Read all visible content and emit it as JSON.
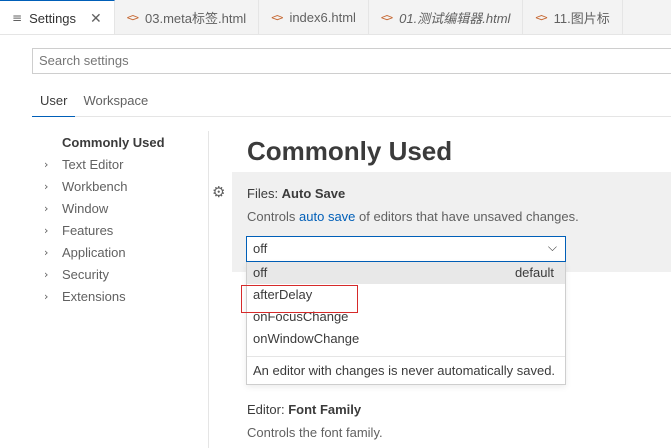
{
  "tabs": [
    {
      "icon": "settings-lines-icon",
      "glyph": "≡",
      "label": "Settings",
      "close": "✕",
      "active": true,
      "italic": false
    },
    {
      "icon": "html-brackets-icon",
      "glyph": "<>",
      "label": "03.meta标签.html",
      "active": false,
      "italic": false
    },
    {
      "icon": "html-brackets-icon",
      "glyph": "<>",
      "label": "index6.html",
      "active": false,
      "italic": false
    },
    {
      "icon": "html-brackets-icon",
      "glyph": "<>",
      "label": "01.测试编辑器.html",
      "active": false,
      "italic": true
    },
    {
      "icon": "html-brackets-icon",
      "glyph": "<>",
      "label": "11.图片标",
      "active": false,
      "italic": false
    }
  ],
  "search": {
    "placeholder": "Search settings"
  },
  "scope": {
    "user": "User",
    "workspace": "Workspace"
  },
  "toc": [
    {
      "label": "Commonly Used",
      "chevron": "",
      "active": true
    },
    {
      "label": "Text Editor",
      "chevron": "›",
      "active": false
    },
    {
      "label": "Workbench",
      "chevron": "›",
      "active": false
    },
    {
      "label": "Window",
      "chevron": "›",
      "active": false
    },
    {
      "label": "Features",
      "chevron": "›",
      "active": false
    },
    {
      "label": "Application",
      "chevron": "›",
      "active": false
    },
    {
      "label": "Security",
      "chevron": "›",
      "active": false
    },
    {
      "label": "Extensions",
      "chevron": "›",
      "active": false
    }
  ],
  "main": {
    "section_title": "Commonly Used",
    "gear_glyph": "⚙",
    "auto_save": {
      "category": "Files: ",
      "name": "Auto Save",
      "desc_before": "Controls ",
      "desc_link": "auto save",
      "desc_after": " of editors that have unsaved changes.",
      "value": "off",
      "arrow": "⌵",
      "options": [
        {
          "label": "off",
          "note": "default",
          "selected": true
        },
        {
          "label": "afterDelay",
          "note": "",
          "selected": false
        },
        {
          "label": "onFocusChange",
          "note": "",
          "selected": false
        },
        {
          "label": "onWindowChange",
          "note": "",
          "selected": false
        }
      ],
      "option_description": "An editor with changes is never automatically saved."
    },
    "font_family": {
      "category": "Editor: ",
      "name": "Font Family",
      "desc": "Controls the font family."
    }
  },
  "colors": {
    "accent": "#005fb8",
    "highlight_box": "#d62a2a"
  }
}
